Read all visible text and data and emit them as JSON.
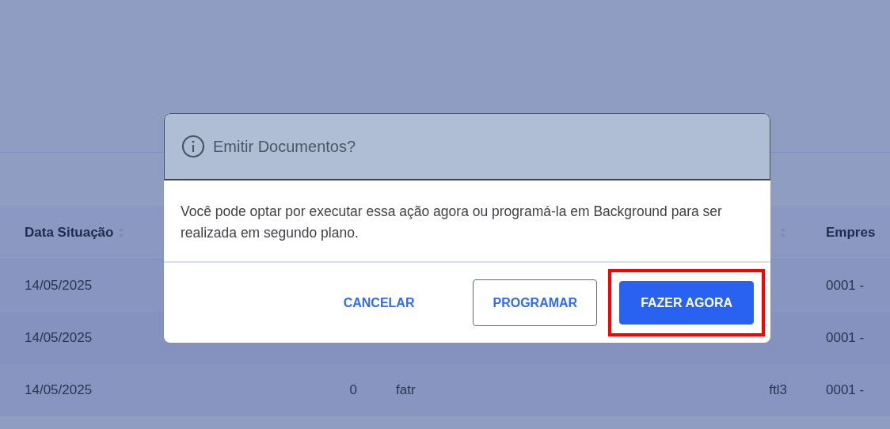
{
  "table": {
    "columns": [
      {
        "label": "Data Situação",
        "sort_icon": true
      },
      {
        "sort_icon": true
      },
      {
        "label": "Empres"
      }
    ],
    "rows": [
      {
        "column_1": "14/05/2025",
        "column_5": "0001 -"
      },
      {
        "column_1": "14/05/2025",
        "column_5": "0001 -"
      },
      {
        "column_1": "14/05/2025",
        "column_2": "0",
        "column_3": "fatr",
        "column_4": "ftl3",
        "column_5": "0001 -"
      }
    ]
  },
  "dialog": {
    "title": "Emitir Documentos?",
    "message": "Você pode optar por executar essa ação agora ou programá-la em Background para ser realizada em segundo plano.",
    "buttons": [
      {
        "label": "CANCELAR",
        "kind": "text",
        "highlighted": false
      },
      {
        "label": "PROGRAMAR",
        "kind": "outline",
        "highlighted": false
      },
      {
        "label": "FAZER AGORA",
        "kind": "primary",
        "highlighted": true
      }
    ]
  }
}
